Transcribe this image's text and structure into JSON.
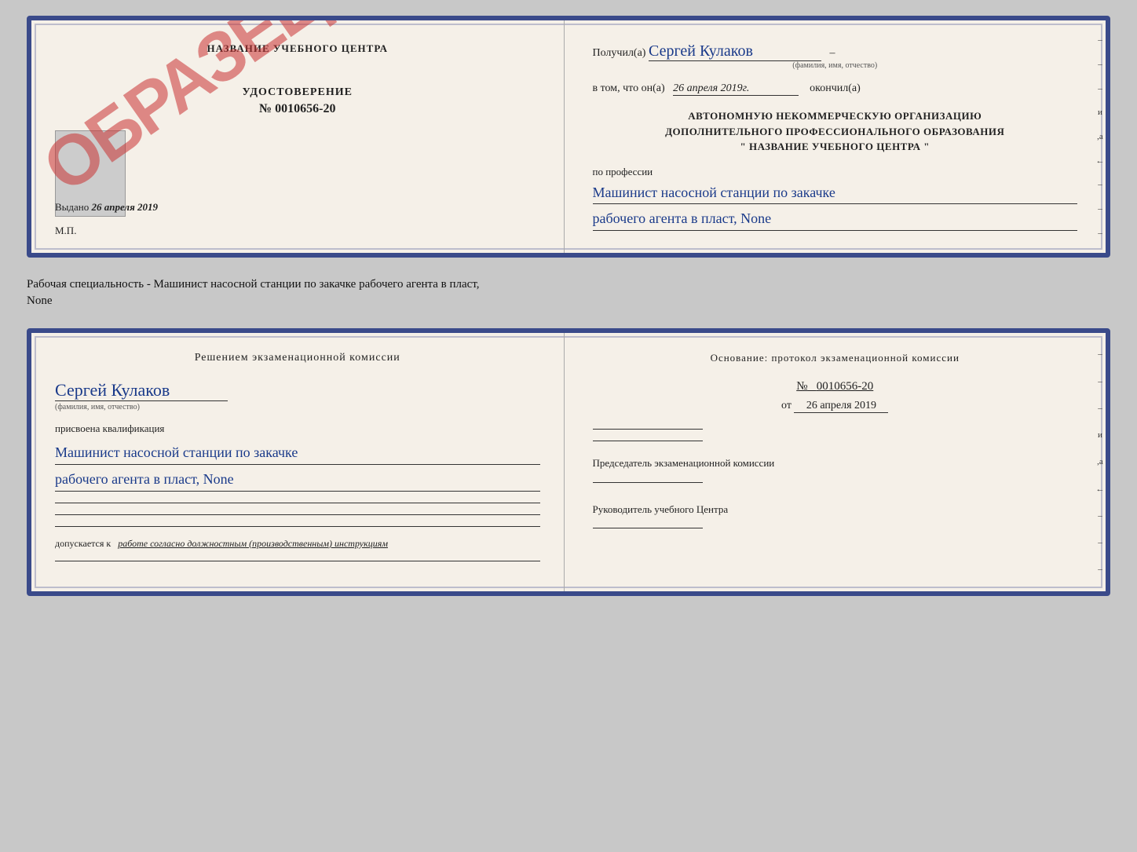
{
  "top_doc": {
    "left": {
      "title": "НАЗВАНИЕ УЧЕБНОГО ЦЕНТРА",
      "stamp": "ОБРАЗЕЦ",
      "cert_title": "УДОСТОВЕРЕНИЕ",
      "cert_number": "№ 0010656-20",
      "issued_label": "Выдано",
      "issued_date": "26 апреля 2019",
      "mp_label": "М.П."
    },
    "right": {
      "received_label": "Получил(а)",
      "received_name": "Сергей Кулаков",
      "fio_hint": "(фамилия, имя, отчество)",
      "date_prefix": "в том, что он(а)",
      "date_value": "26 апреля 2019г.",
      "date_suffix": "окончил(а)",
      "org_line1": "АВТОНОМНУЮ НЕКОММЕРЧЕСКУЮ ОРГАНИЗАЦИЮ",
      "org_line2": "ДОПОЛНИТЕЛЬНОГО ПРОФЕССИОНАЛЬНОГО ОБРАЗОВАНИЯ",
      "org_line3": "\"   НАЗВАНИЕ УЧЕБНОГО ЦЕНТРА   \"",
      "profession_label": "по профессии",
      "profession_line1": "Машинист насосной станции по закачке",
      "profession_line2": "рабочего агента в пласт, None",
      "side_dashes": [
        "-",
        "-",
        "-",
        "и",
        ",а",
        "←",
        "-",
        "-",
        "-"
      ]
    }
  },
  "between_label": "Рабочая специальность - Машинист насосной станции по закачке рабочего агента в пласт,\nNone",
  "bottom_doc": {
    "left": {
      "commission_title": "Решением экзаменационной комиссии",
      "person_name": "Сергей Кулаков",
      "fio_hint": "(фамилия, имя, отчество)",
      "qualification_label": "присвоена квалификация",
      "qualification_line1": "Машинист насосной станции по закачке",
      "qualification_line2": "рабочего агента в пласт, None",
      "допускается_prefix": "допускается к",
      "допускается_value": "работе согласно должностным (производственным) инструкциям"
    },
    "right": {
      "basis_title": "Основание: протокол экзаменационной комиссии",
      "protocol_prefix": "№",
      "protocol_number": "0010656-20",
      "date_prefix": "от",
      "date_value": "26 апреля 2019",
      "chairman_label": "Председатель экзаменационной комиссии",
      "head_label": "Руководитель учебного Центра",
      "side_dashes": [
        "-",
        "-",
        "-",
        "и",
        ",а",
        "←",
        "-",
        "-",
        "-"
      ]
    }
  }
}
